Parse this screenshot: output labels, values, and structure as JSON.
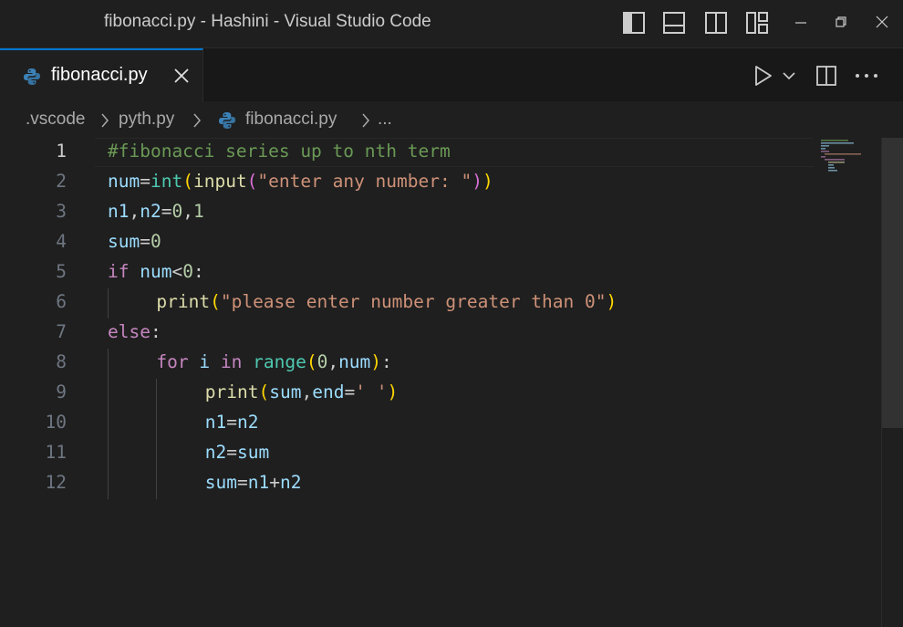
{
  "window": {
    "title": "fibonacci.py - Hashini - Visual Studio Code"
  },
  "tabs": [
    {
      "label": "fibonacci.py",
      "active": true,
      "icon": "python-icon"
    }
  ],
  "breadcrumb": [
    {
      "label": ".vscode"
    },
    {
      "label": "pyth.py"
    },
    {
      "label": "fibonacci.py",
      "icon": "python-icon"
    },
    {
      "label": "..."
    }
  ],
  "editor": {
    "active_line": 1,
    "lines": [
      {
        "n": "1",
        "indent": 0,
        "tokens": [
          [
            "cm",
            "#fibonacci series up to nth term"
          ]
        ]
      },
      {
        "n": "2",
        "indent": 0,
        "tokens": [
          [
            "var",
            "num"
          ],
          [
            "op",
            "="
          ],
          [
            "bi",
            "int"
          ],
          [
            "b1",
            "("
          ],
          [
            "fn",
            "input"
          ],
          [
            "b2",
            "("
          ],
          [
            "str",
            "\"enter any number: \""
          ],
          [
            "b2",
            ")"
          ],
          [
            "b1",
            ")"
          ]
        ]
      },
      {
        "n": "3",
        "indent": 0,
        "tokens": [
          [
            "var",
            "n1"
          ],
          [
            "op",
            ","
          ],
          [
            "var",
            "n2"
          ],
          [
            "op",
            "="
          ],
          [
            "num",
            "0"
          ],
          [
            "op",
            ","
          ],
          [
            "num",
            "1"
          ]
        ]
      },
      {
        "n": "4",
        "indent": 0,
        "tokens": [
          [
            "var",
            "sum"
          ],
          [
            "op",
            "="
          ],
          [
            "num",
            "0"
          ]
        ]
      },
      {
        "n": "5",
        "indent": 0,
        "tokens": [
          [
            "kw",
            "if"
          ],
          [
            "op",
            " "
          ],
          [
            "var",
            "num"
          ],
          [
            "op",
            "<"
          ],
          [
            "num",
            "0"
          ],
          [
            "op",
            ":"
          ]
        ]
      },
      {
        "n": "6",
        "indent": 1,
        "tokens": [
          [
            "fn",
            "print"
          ],
          [
            "b1",
            "("
          ],
          [
            "str",
            "\"please enter number greater than 0\""
          ],
          [
            "b1",
            ")"
          ]
        ]
      },
      {
        "n": "7",
        "indent": 0,
        "tokens": [
          [
            "kw",
            "else"
          ],
          [
            "op",
            ":"
          ]
        ]
      },
      {
        "n": "8",
        "indent": 1,
        "tokens": [
          [
            "kw",
            "for"
          ],
          [
            "op",
            " "
          ],
          [
            "var",
            "i"
          ],
          [
            "op",
            " "
          ],
          [
            "kw",
            "in"
          ],
          [
            "op",
            " "
          ],
          [
            "bi",
            "range"
          ],
          [
            "b1",
            "("
          ],
          [
            "num",
            "0"
          ],
          [
            "op",
            ","
          ],
          [
            "var",
            "num"
          ],
          [
            "b1",
            ")"
          ],
          [
            "op",
            ":"
          ]
        ]
      },
      {
        "n": "9",
        "indent": 2,
        "tokens": [
          [
            "fn",
            "print"
          ],
          [
            "b1",
            "("
          ],
          [
            "var",
            "sum"
          ],
          [
            "op",
            ","
          ],
          [
            "var",
            "end"
          ],
          [
            "op",
            "="
          ],
          [
            "str",
            "' '"
          ],
          [
            "b1",
            ")"
          ]
        ]
      },
      {
        "n": "10",
        "indent": 2,
        "tokens": [
          [
            "var",
            "n1"
          ],
          [
            "op",
            "="
          ],
          [
            "var",
            "n2"
          ]
        ]
      },
      {
        "n": "11",
        "indent": 2,
        "tokens": [
          [
            "var",
            "n2"
          ],
          [
            "op",
            "="
          ],
          [
            "var",
            "sum"
          ]
        ]
      },
      {
        "n": "12",
        "indent": 2,
        "tokens": [
          [
            "var",
            "sum"
          ],
          [
            "op",
            "="
          ],
          [
            "var",
            "n1"
          ],
          [
            "op",
            "+"
          ],
          [
            "var",
            "n2"
          ]
        ]
      }
    ]
  },
  "colors": {
    "accent": "#0078d4",
    "editor_bg": "#1f1f1f",
    "python_blue": "#3b82b8",
    "python_yellow": "#f2c94c"
  }
}
